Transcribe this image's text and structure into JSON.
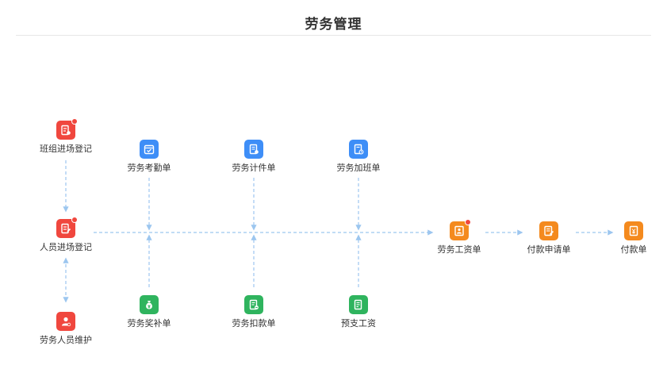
{
  "header": {
    "title": "劳务管理"
  },
  "colors": {
    "red": "#f0473e",
    "blue": "#3e8ef7",
    "green": "#2fb45e",
    "orange": "#f48a1e",
    "line": "#9cc6ef"
  },
  "nodes": {
    "team_entry": {
      "label": "班组进场登记",
      "icon": "team-entry-icon"
    },
    "person_entry": {
      "label": "人员进场登记",
      "icon": "person-entry-icon"
    },
    "person_maint": {
      "label": "劳务人员维护",
      "icon": "person-maintain-icon"
    },
    "attendance": {
      "label": "劳务考勤单",
      "icon": "calendar-check-icon"
    },
    "piecework": {
      "label": "劳务计件单",
      "icon": "document-list-icon"
    },
    "overtime": {
      "label": "劳务加班单",
      "icon": "clock-document-icon"
    },
    "bonus": {
      "label": "劳务奖补单",
      "icon": "money-bag-icon"
    },
    "deduction": {
      "label": "劳务扣款单",
      "icon": "deduction-icon"
    },
    "advance": {
      "label": "预支工资",
      "icon": "advance-document-icon"
    },
    "payroll": {
      "label": "劳务工资单",
      "icon": "payroll-icon"
    },
    "pay_request": {
      "label": "付款申请单",
      "icon": "payment-request-icon"
    },
    "payment": {
      "label": "付款单",
      "icon": "payment-icon"
    }
  }
}
